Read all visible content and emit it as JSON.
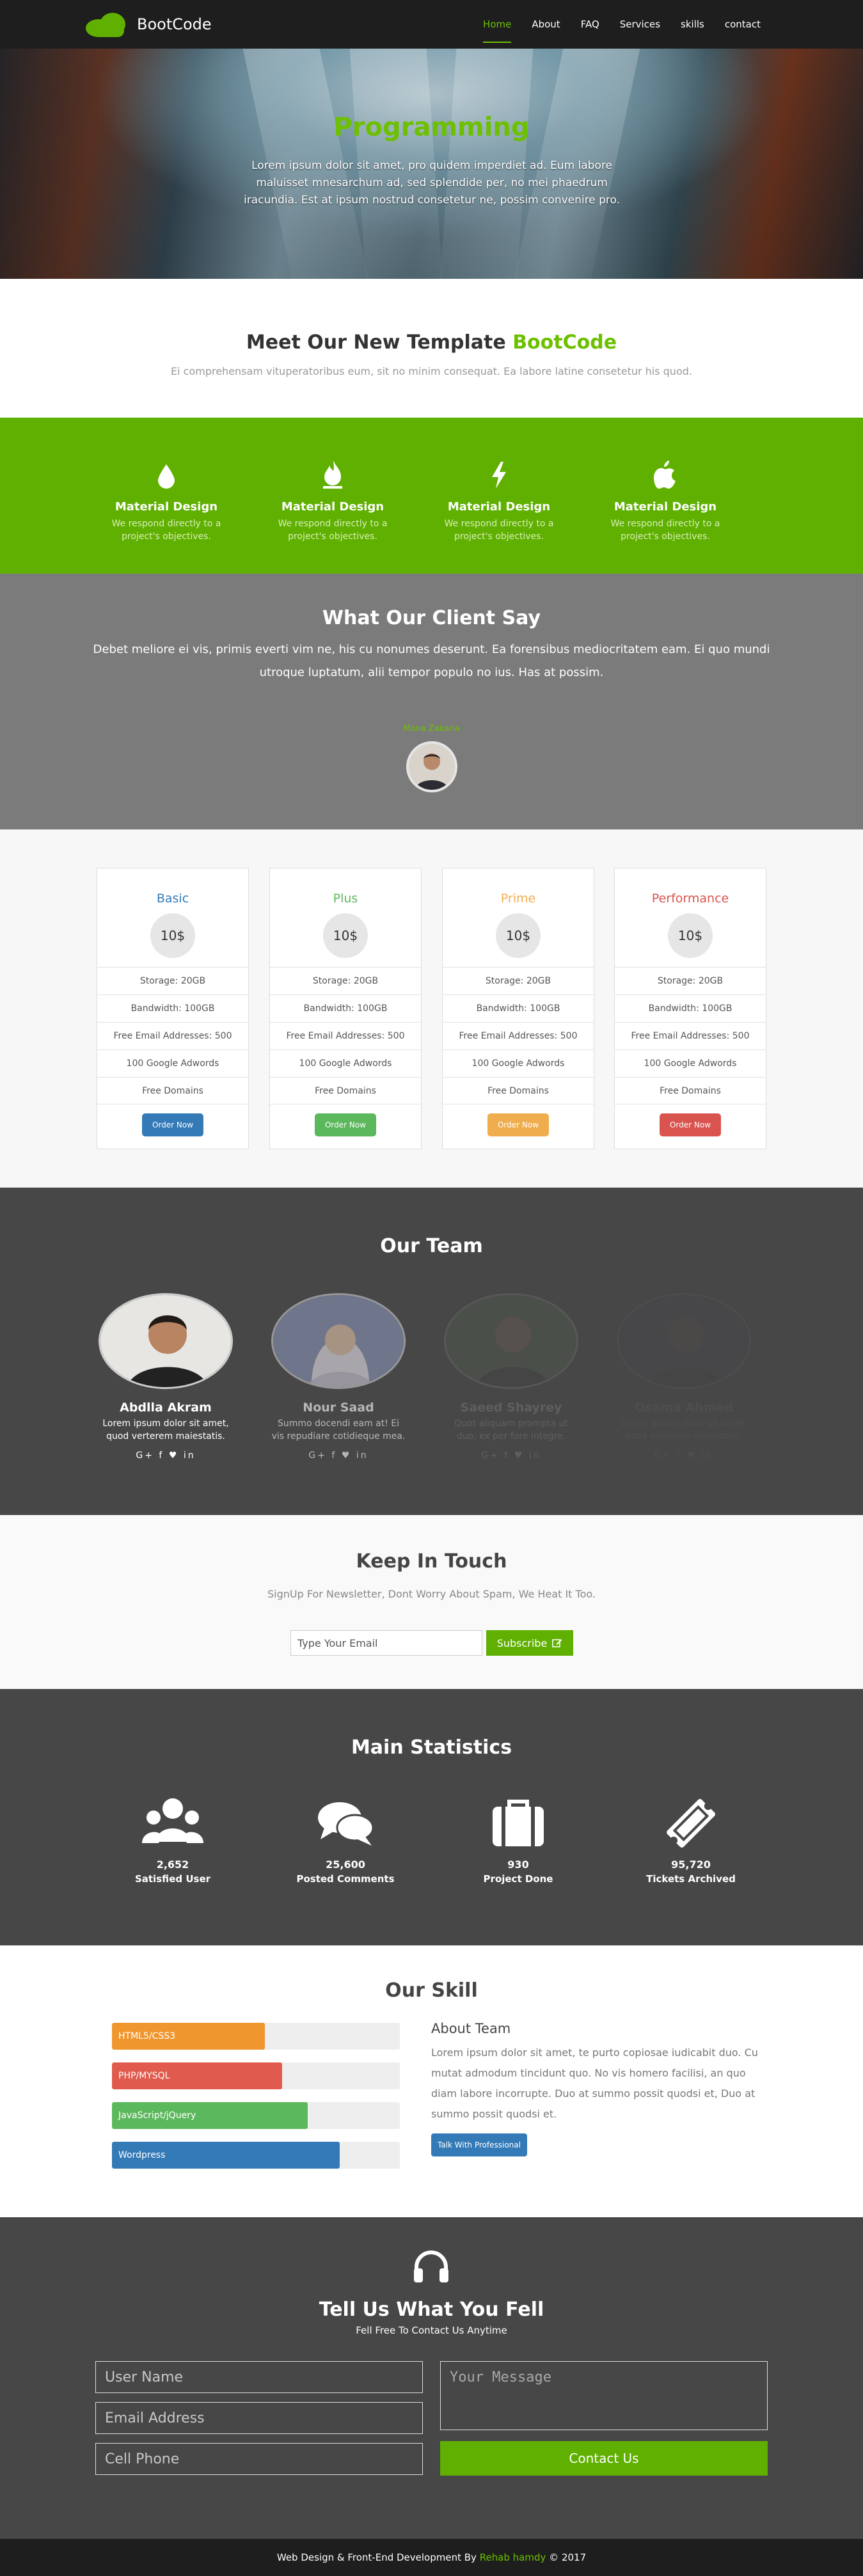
{
  "brand": {
    "name": "BootCode",
    "accent": "#5fb000",
    "dark": "#474747"
  },
  "nav": {
    "items": [
      {
        "label": "Home",
        "active": true
      },
      {
        "label": "About"
      },
      {
        "label": "FAQ"
      },
      {
        "label": "Services"
      },
      {
        "label": "skills"
      },
      {
        "label": "contact"
      }
    ]
  },
  "hero": {
    "title": "Programming",
    "text": "Lorem ipsum dolor sit amet, pro quidem imperdiet ad. Eum labore maluisset mnesarchum ad, sed splendide per, no mei phaedrum iracundia. Est at ipsum nostrud consetetur ne, possim convenire pro."
  },
  "intro": {
    "title_prefix": "Meet Our New Template",
    "title_highlight": "BootCode",
    "subtitle": "Ei comprehensam vituperatoribus eum, sit no minim consequat. Ea labore latine consetetur his quod."
  },
  "features": [
    {
      "icon": "tint-icon",
      "title": "Material Design",
      "text": "We respond directly to a project's objectives."
    },
    {
      "icon": "fire-icon",
      "title": "Material Design",
      "text": "We respond directly to a project's objectives."
    },
    {
      "icon": "bolt-icon",
      "title": "Material Design",
      "text": "We respond directly to a project's objectives."
    },
    {
      "icon": "apple-icon",
      "title": "Material Design",
      "text": "We respond directly to a project's objectives."
    }
  ],
  "testimonial": {
    "title": "What Our Client Say",
    "text": "Debet meliore ei vis, primis everti vim ne, his cu nonumes deserunt. Ea forensibus mediocritatem eam. Ei quo mundi utroque luptatum, alii tempor populo no ius. Has at possim.",
    "author": "Mona Zakaria"
  },
  "pricing": {
    "plans": [
      {
        "name": "Basic",
        "color": "#337ab7",
        "price": "10$",
        "features": [
          "Storage: 20GB",
          "Bandwidth: 100GB",
          "Free Email Addresses: 500",
          "100 Google Adwords",
          "Free Domains"
        ],
        "button": "Order Now"
      },
      {
        "name": "Plus",
        "color": "#5cb85c",
        "price": "10$",
        "features": [
          "Storage: 20GB",
          "Bandwidth: 100GB",
          "Free Email Addresses: 500",
          "100 Google Adwords",
          "Free Domains"
        ],
        "button": "Order Now"
      },
      {
        "name": "Prime",
        "color": "#f0ad4e",
        "price": "10$",
        "features": [
          "Storage: 20GB",
          "Bandwidth: 100GB",
          "Free Email Addresses: 500",
          "100 Google Adwords",
          "Free Domains"
        ],
        "button": "Order Now"
      },
      {
        "name": "Performance",
        "color": "#d9534f",
        "price": "10$",
        "features": [
          "Storage: 20GB",
          "Bandwidth: 100GB",
          "Free Email Addresses: 500",
          "100 Google Adwords",
          "Free Domains"
        ],
        "button": "Order Now"
      }
    ]
  },
  "team": {
    "title": "Our Team",
    "members": [
      {
        "name": "Abdlla Akram",
        "bio": "Lorem ipsum dolor sit amet, quod verterem maiestatis.",
        "social": "G+ f ♥ in"
      },
      {
        "name": "Nour Saad",
        "bio": "Summo docendi eam at! Ei vis repudiare cotidieque mea.",
        "social": "G+ f ♥ in"
      },
      {
        "name": "Saeed Shayrey",
        "bio": "Quot aliquam prompta ut duo, ex per fore integre.",
        "social": "G+ f ♥ in"
      },
      {
        "name": "Osama Ahmed",
        "bio": "Lorem ipsum dolor sit amet, quod verterem maiestatis.",
        "social": "G+ f ♥ in"
      }
    ]
  },
  "newsletter": {
    "title": "Keep In Touch",
    "text": "SignUp For Newsletter, Dont Worry About Spam, We Heat It Too.",
    "placeholder": "Type Your Email",
    "button": "Subscribe"
  },
  "stats": {
    "title": "Main Statistics",
    "items": [
      {
        "icon": "users-icon",
        "value": "2,652",
        "label": "Satisfied User"
      },
      {
        "icon": "comments-icon",
        "value": "25,600",
        "label": "Posted Comments"
      },
      {
        "icon": "briefcase-icon",
        "value": "930",
        "label": "Project Done"
      },
      {
        "icon": "ticket-icon",
        "value": "95,720",
        "label": "Tickets Archived"
      }
    ]
  },
  "skills": {
    "title": "Our Skill",
    "bars": [
      {
        "label": "HTML5/CSS3",
        "percent": 53,
        "color": "#f0962e"
      },
      {
        "label": "PHP/MYSQL",
        "percent": 59,
        "color": "#e05a4d"
      },
      {
        "label": "JavaScript/jQuery",
        "percent": 68,
        "color": "#5cb85c"
      },
      {
        "label": "Wordpress",
        "percent": 79,
        "color": "#337ab7"
      }
    ],
    "about_title": "About Team",
    "about_text": "Lorem ipsum dolor sit amet, te purto copiosae iudicabit duo. Cu mutat admodum tincidunt quo. No vis homero facilisi, an quo diam labore incorrupte. Duo at summo possit quodsi et, Duo at summo possit quodsi et.",
    "about_button": "Talk With Professional"
  },
  "contact": {
    "title": "Tell Us What You Fell",
    "subtitle": "Fell Free To Contact Us Anytime",
    "name_placeholder": "User Name",
    "email_placeholder": "Email Address",
    "phone_placeholder": "Cell Phone",
    "message_placeholder": "Your Message",
    "button": "Contact Us"
  },
  "footer": {
    "prefix": "Web Design & Front-End Development By",
    "author": "Rehab hamdy",
    "suffix": "© 2017"
  }
}
